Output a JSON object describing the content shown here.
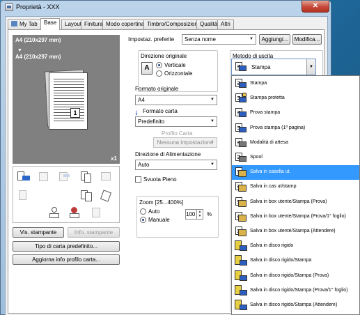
{
  "window": {
    "title": "Proprietà - XXX",
    "close_label": "✕"
  },
  "tabs": [
    {
      "label": "My Tab"
    },
    {
      "label": "Base"
    },
    {
      "label": "Layout"
    },
    {
      "label": "Finitura"
    },
    {
      "label": "Modo copertina"
    },
    {
      "label": "Timbro/Composizione"
    },
    {
      "label": "Qualità"
    },
    {
      "label": "Altri"
    }
  ],
  "preview": {
    "size_line_1": "A4 (210x297 mm)",
    "arrow": "▼",
    "size_line_2": "A4 (210x297 mm)",
    "page_number": "1",
    "copies": "x1"
  },
  "left_buttons": {
    "printer_view": "Vis. stampante",
    "printer_info": "Info. stampante",
    "default_paper_type": "Tipo di carta predefinito...",
    "update_paper_profile": "Aggiorna info profilo carta..."
  },
  "preferences": {
    "label": "Impostaz. preferite",
    "value": "Senza nome",
    "add_button": "Aggiungi...",
    "edit_button": "Modifica..."
  },
  "orientation": {
    "label": "Direzione originale",
    "icon_glyph": "A",
    "options": [
      "Verticale",
      "Orizzontale"
    ],
    "selected": "Verticale"
  },
  "original_size": {
    "label": "Formato originale",
    "value": "A4"
  },
  "paper_size": {
    "label": "Formato carta",
    "value": "Predefinito"
  },
  "paper_profile": {
    "label": "Profilo Carta",
    "value": "Nessuna impostazione"
  },
  "feed_direction": {
    "label": "Direzione di Alimentazione",
    "value": "Auto"
  },
  "empty_full": {
    "label": "Svuota Pieno",
    "checked": false
  },
  "zoom": {
    "label": "Zoom [25...400%]",
    "options": [
      "Auto",
      "Manuale"
    ],
    "selected": "Manuale",
    "value": "100",
    "unit": "%"
  },
  "output_method": {
    "label": "Metodo di uscita",
    "value": "Stampa",
    "items": [
      {
        "label": "Stampa",
        "icon": "print-icon",
        "selected": false
      },
      {
        "label": "Stampa protetta",
        "icon": "secure-print-icon",
        "selected": false
      },
      {
        "label": "Prova stampa",
        "icon": "proof-print-icon",
        "selected": false
      },
      {
        "label": "Prova stampa (1ª pagina)",
        "icon": "proof-first-page-icon",
        "selected": false
      },
      {
        "label": "Modalità di attesa",
        "icon": "wait-mode-icon",
        "selected": false
      },
      {
        "label": "Spool",
        "icon": "spool-icon",
        "selected": false
      },
      {
        "label": "Salva in casella ut.",
        "icon": "save-box-icon",
        "selected": true
      },
      {
        "label": "Salva in cas ut/stamp",
        "icon": "save-box-print-icon",
        "selected": false
      },
      {
        "label": "Salva in box utente/Stampa (Prova)",
        "icon": "save-box-proof-icon",
        "selected": false
      },
      {
        "label": "Salva in box utente/Stampa (Prova/1° foglio)",
        "icon": "save-box-proof-first-icon",
        "selected": false
      },
      {
        "label": "Salva in box utente/Stampa (Attendere)",
        "icon": "save-box-wait-icon",
        "selected": false
      },
      {
        "label": "Salva in disco rigido",
        "icon": "hard-disk-icon",
        "selected": false
      },
      {
        "label": "Salva in disco rigido/Stampa",
        "icon": "hard-disk-print-icon",
        "selected": false
      },
      {
        "label": "Salva in disco rigido/Stampa (Prova)",
        "icon": "hard-disk-proof-icon",
        "selected": false
      },
      {
        "label": "Salva in disco rigido/Stampa (Prova/1° foglio)",
        "icon": "hard-disk-proof-first-icon",
        "selected": false
      },
      {
        "label": "Salva in disco rigido/Stampa (Attendere)",
        "icon": "hard-disk-wait-icon",
        "selected": false
      }
    ]
  },
  "colors": {
    "selection": "#3399ff",
    "preview_bg": "#808080",
    "accent_blue": "#2b66c8"
  }
}
